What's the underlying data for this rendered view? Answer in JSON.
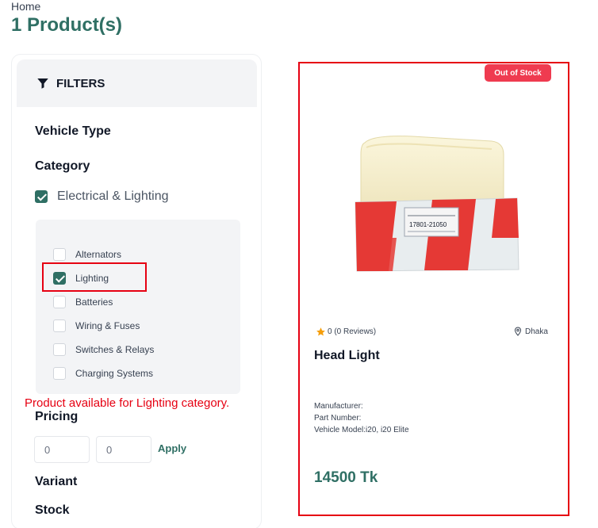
{
  "breadcrumb": "Home",
  "page_title": "1 Product(s)",
  "filters": {
    "header": "FILTERS",
    "vehicle_type": "Vehicle Type",
    "category": "Category",
    "main_category": {
      "label": "Electrical & Lighting",
      "checked": true
    },
    "subcategories": [
      {
        "label": "Alternators",
        "checked": false
      },
      {
        "label": "Lighting",
        "checked": true
      },
      {
        "label": "Batteries",
        "checked": false
      },
      {
        "label": "Wiring & Fuses",
        "checked": false
      },
      {
        "label": "Switches & Relays",
        "checked": false
      },
      {
        "label": "Charging Systems",
        "checked": false
      }
    ],
    "pricing": "Pricing",
    "price_min": "0",
    "price_max": "0",
    "apply": "Apply",
    "variant": "Variant",
    "stock": "Stock"
  },
  "annotation": "Product available for Lighting category.",
  "product": {
    "badge": "Out of Stock",
    "rating": "0 (0 Reviews)",
    "location": "Dhaka",
    "name": "Head Light",
    "manufacturer": "Manufacturer:",
    "part_number": "Part Number:",
    "vehicle_model": "Vehicle Model:i20, i20 Elite",
    "price": "14500 Tk",
    "box_code": "17801-21050"
  },
  "colors": {
    "brand": "#2f6f64",
    "annotation_red": "#e60012",
    "badge_red": "#ef3b50"
  }
}
